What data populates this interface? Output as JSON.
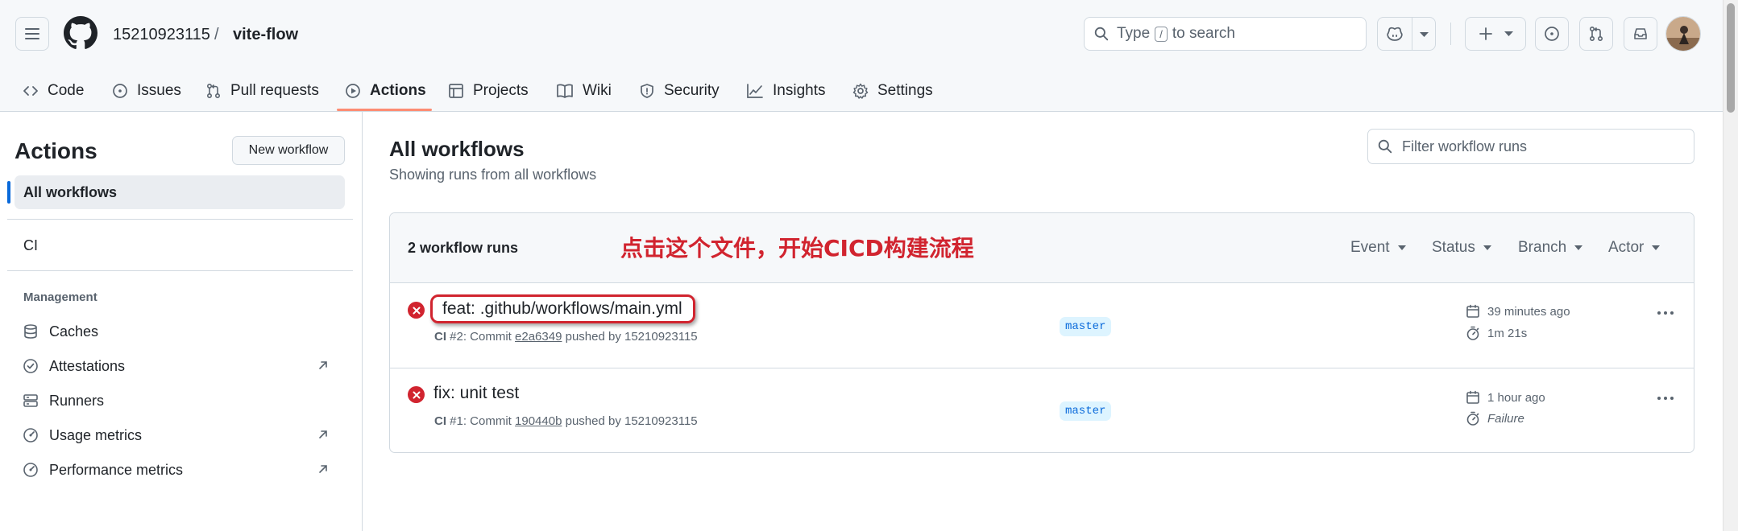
{
  "header": {
    "owner": "15210923115",
    "separator": "/",
    "repo": "vite-flow",
    "search": {
      "before": "Type",
      "key": "/",
      "after": "to search"
    }
  },
  "tabs": [
    {
      "label": "Code",
      "icon": "code-icon"
    },
    {
      "label": "Issues",
      "icon": "issue-opened-icon"
    },
    {
      "label": "Pull requests",
      "icon": "git-pull-request-icon"
    },
    {
      "label": "Actions",
      "icon": "play-icon",
      "active": true
    },
    {
      "label": "Projects",
      "icon": "table-icon"
    },
    {
      "label": "Wiki",
      "icon": "book-icon"
    },
    {
      "label": "Security",
      "icon": "shield-icon"
    },
    {
      "label": "Insights",
      "icon": "graph-icon"
    },
    {
      "label": "Settings",
      "icon": "gear-icon"
    }
  ],
  "sidebar": {
    "title": "Actions",
    "new_workflow": "New workflow",
    "all_workflows": "All workflows",
    "workflows": [
      "CI"
    ],
    "management_heading": "Management",
    "management": [
      {
        "label": "Caches",
        "icon": "cache-icon",
        "external": false
      },
      {
        "label": "Attestations",
        "icon": "verified-icon",
        "external": true
      },
      {
        "label": "Runners",
        "icon": "server-icon",
        "external": false
      },
      {
        "label": "Usage metrics",
        "icon": "meter-icon",
        "external": true
      },
      {
        "label": "Performance metrics",
        "icon": "meter-icon",
        "external": true
      }
    ]
  },
  "main": {
    "title": "All workflows",
    "subtitle": "Showing runs from all workflows",
    "filter_placeholder": "Filter workflow runs",
    "runs_count": "2 workflow runs",
    "annotation": "点击这个文件，开始CICD构建流程",
    "filters": [
      "Event",
      "Status",
      "Branch",
      "Actor"
    ],
    "runs": [
      {
        "title": "feat: .github/workflows/main.yml",
        "workflow": "CI",
        "meta_mid": " #2: Commit ",
        "sha": "e2a6349",
        "meta_end": " pushed by 15210923115",
        "branch": "master",
        "time": "39 minutes ago",
        "duration": "1m 21s",
        "status": "failure"
      },
      {
        "title": "fix: unit test",
        "workflow": "CI",
        "meta_mid": " #1: Commit ",
        "sha": "190440b",
        "meta_end": " pushed by 15210923115",
        "branch": "master",
        "time": "1 hour ago",
        "duration": "Failure",
        "status": "failure"
      }
    ]
  },
  "colors": {
    "accent": "#0969da",
    "failure": "#d1242f",
    "tab_underline": "#fd8c73",
    "annotation": "#d1242f"
  }
}
